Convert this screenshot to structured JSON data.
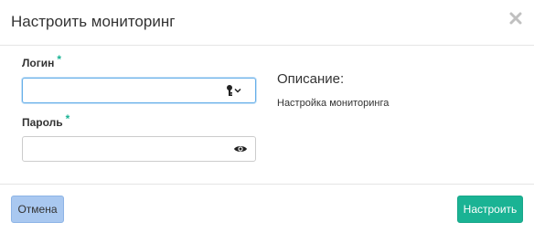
{
  "modal": {
    "title": "Настроить мониторинг",
    "close_icon": "close-icon"
  },
  "form": {
    "login": {
      "label": "Логин",
      "required_mark": "*",
      "value": "",
      "icon": "key-dropdown-icon"
    },
    "password": {
      "label": "Пароль",
      "required_mark": "*",
      "value": "",
      "icon": "eye-icon"
    }
  },
  "description": {
    "heading": "Описание:",
    "text": "Настройка мониторинга"
  },
  "footer": {
    "cancel_label": "Отмена",
    "submit_label": "Настроить"
  },
  "colors": {
    "accent": "#1ab394",
    "cancel_bg": "#a9c8f0",
    "focus_border": "#66afe9"
  }
}
